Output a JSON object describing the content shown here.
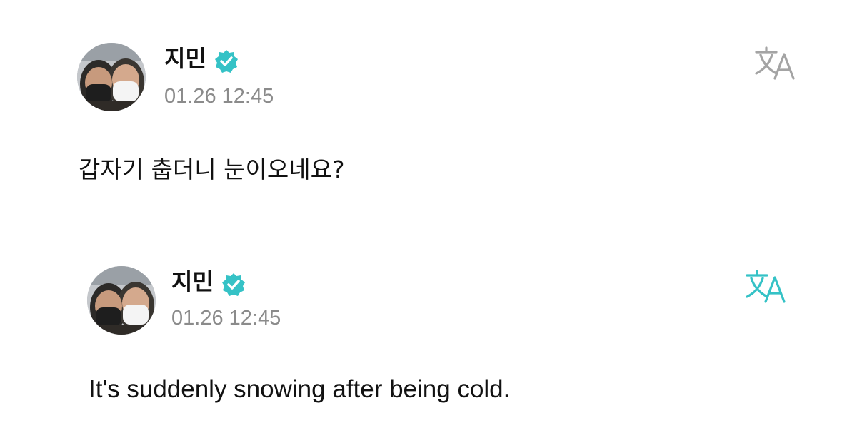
{
  "colors": {
    "accent": "#35c2c6",
    "translate_inactive": "#a4a4a4",
    "timestamp": "#8b8b8b",
    "text": "#111111",
    "background": "#ffffff"
  },
  "posts": [
    {
      "author": "지민",
      "verified_icon": "verified-check-icon",
      "timestamp": "01.26 12:45",
      "translate_icon": "translate-icon",
      "translate_state": "inactive",
      "text": "갑자기 춥더니 눈이오네요?"
    },
    {
      "author": "지민",
      "verified_icon": "verified-check-icon",
      "timestamp": "01.26 12:45",
      "translate_icon": "translate-icon",
      "translate_state": "active",
      "text": "It's suddenly snowing after being cold."
    }
  ]
}
